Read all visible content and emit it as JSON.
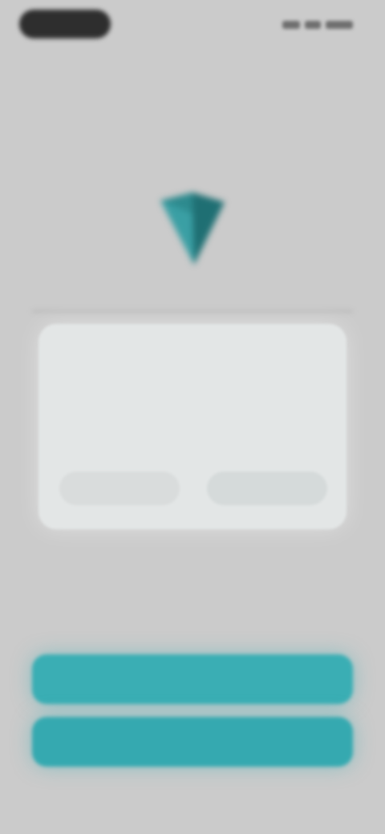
{
  "status_bar": {
    "time": "",
    "icons": [
      "signal-icon",
      "wifi-icon",
      "battery-icon"
    ]
  },
  "logo": {
    "icon": "shield-logo-icon",
    "color": "#2d8a8e"
  },
  "dialog": {
    "title": "",
    "body": "",
    "secondary_label": "",
    "primary_label": ""
  },
  "buttons": {
    "primary_label": "",
    "secondary_label": ""
  },
  "colors": {
    "accent": "#3aaeb4",
    "background": "#cbcbcb",
    "dialog": "#e3e6e6"
  }
}
